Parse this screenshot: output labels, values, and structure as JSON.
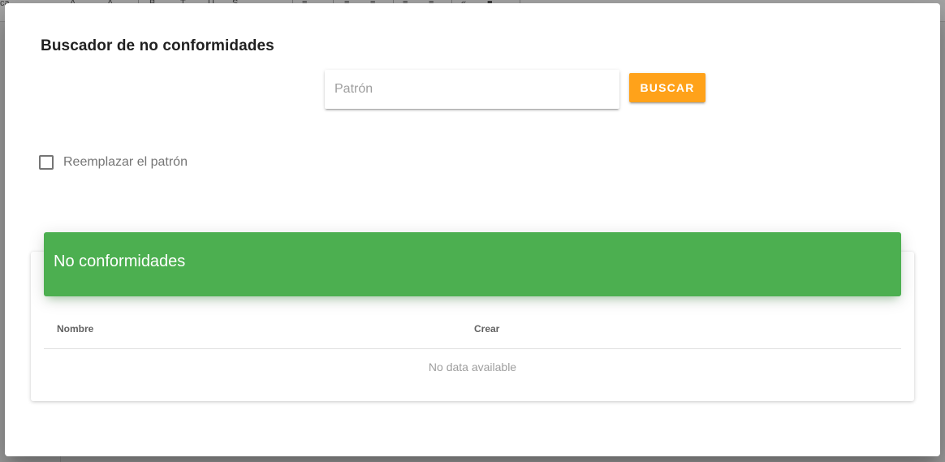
{
  "background": {
    "toolbar_glyphs": [
      "ca",
      "A",
      "A",
      "B",
      "T",
      "U",
      "S",
      "≡",
      "≡",
      "≡",
      "≡",
      "≡",
      "«",
      "■"
    ]
  },
  "dialog": {
    "title": "Buscador de no conformidades",
    "search": {
      "placeholder": "Patrón",
      "value": ""
    },
    "search_button_label": "BUSCAR",
    "replace_checkbox": {
      "label": "Reemplazar el patrón",
      "checked": false
    },
    "card": {
      "title": "No conformidades",
      "columns": [
        "Nombre",
        "Crear"
      ],
      "rows": [],
      "empty_text": "No data available"
    }
  },
  "colors": {
    "accent_button": "#ffa21a",
    "card_header": "#4caf50"
  }
}
